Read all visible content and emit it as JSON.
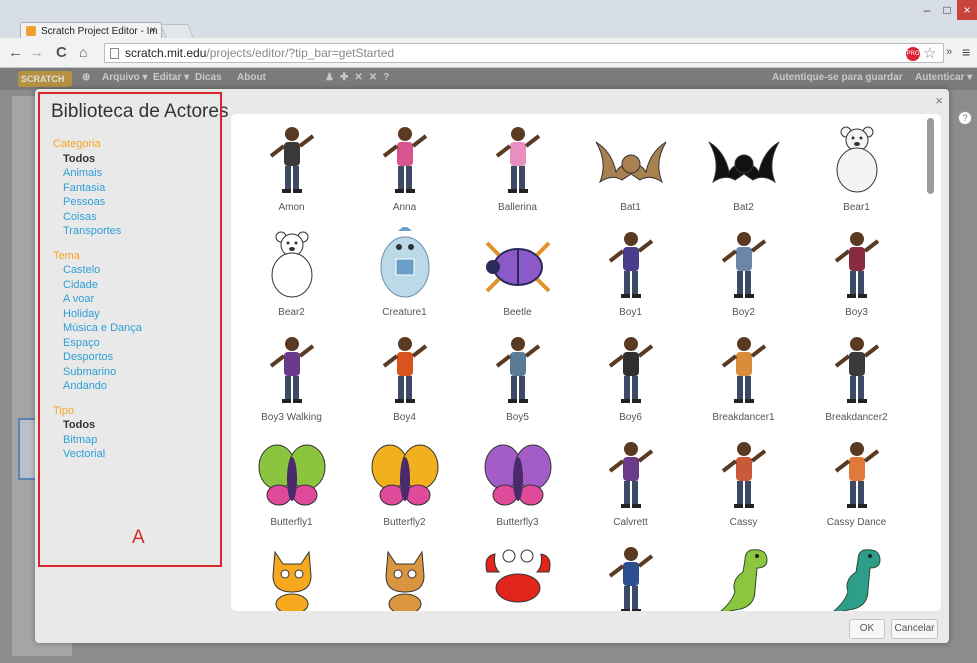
{
  "browser": {
    "tab_title": "Scratch Project Editor - Im",
    "tab_close": "×",
    "url_host": "scratch.mit.edu",
    "url_path": "/projects/editor/?tip_bar=getStarted",
    "window_min": "–",
    "window_max": "□",
    "window_close": "×"
  },
  "scratch_menu": {
    "logo": "SCRATCH",
    "items": [
      "Arquivo ▾",
      "Editar ▾",
      "Dicas",
      "About"
    ],
    "save_hint": "Autentique-se para guardar",
    "signin": "Autenticar ▾"
  },
  "dialog": {
    "title": "Biblioteca de Actores",
    "close": "×",
    "ok_label": "OK",
    "cancel_label": "Cancelar",
    "help": "?",
    "annotation": "A"
  },
  "categories": {
    "categoria_head": "Categoria",
    "categoria_items": [
      "Todos",
      "Animais",
      "Fantasia",
      "Pessoas",
      "Coisas",
      "Transportes"
    ],
    "tema_head": "Tema",
    "tema_items": [
      "Castelo",
      "Cidade",
      "A voar",
      "Holiday",
      "Música e Dança",
      "Espaço",
      "Desportos",
      "Submarino",
      "Andando"
    ],
    "tipo_head": "Tipo",
    "tipo_items": [
      "Todos",
      "Bitmap",
      "Vectorial"
    ]
  },
  "sprites": [
    {
      "name": "Amon",
      "icon": "person-icon",
      "color": "#3a3a3a"
    },
    {
      "name": "Anna",
      "icon": "person-icon",
      "color": "#d9548f"
    },
    {
      "name": "Ballerina",
      "icon": "person-icon",
      "color": "#e88fc0"
    },
    {
      "name": "Bat1",
      "icon": "bat-icon",
      "color": "#a9804f"
    },
    {
      "name": "Bat2",
      "icon": "bat-icon",
      "color": "#111111"
    },
    {
      "name": "Bear1",
      "icon": "bear-icon",
      "color": "#f4f4f4"
    },
    {
      "name": "Bear2",
      "icon": "bear-icon",
      "color": "#ffffff"
    },
    {
      "name": "Creature1",
      "icon": "creature-icon",
      "color": "#bcd9e8"
    },
    {
      "name": "Beetle",
      "icon": "beetle-icon",
      "color": "#8c5ac8"
    },
    {
      "name": "Boy1",
      "icon": "person-icon",
      "color": "#4a3d8c"
    },
    {
      "name": "Boy2",
      "icon": "person-icon",
      "color": "#6c86a8"
    },
    {
      "name": "Boy3",
      "icon": "person-icon",
      "color": "#8a2b3f"
    },
    {
      "name": "Boy3 Walking",
      "icon": "person-icon",
      "color": "#6a3a8a"
    },
    {
      "name": "Boy4",
      "icon": "person-icon",
      "color": "#d9531e"
    },
    {
      "name": "Boy5",
      "icon": "person-icon",
      "color": "#5a7b96"
    },
    {
      "name": "Boy6",
      "icon": "person-icon",
      "color": "#2f2f2f"
    },
    {
      "name": "Breakdancer1",
      "icon": "person-icon",
      "color": "#d98c3a"
    },
    {
      "name": "Breakdancer2",
      "icon": "person-icon",
      "color": "#3a3a3a"
    },
    {
      "name": "Butterfly1",
      "icon": "butterfly-icon",
      "color": "#8bc53f"
    },
    {
      "name": "Butterfly2",
      "icon": "butterfly-icon",
      "color": "#f2b01e"
    },
    {
      "name": "Butterfly3",
      "icon": "butterfly-icon",
      "color": "#a35cc8"
    },
    {
      "name": "Calvrett",
      "icon": "person-icon",
      "color": "#6b3a8a"
    },
    {
      "name": "Cassy",
      "icon": "person-icon",
      "color": "#c85a3a"
    },
    {
      "name": "Cassy Dance",
      "icon": "person-icon",
      "color": "#e07a3a"
    },
    {
      "name": "",
      "icon": "cat-icon",
      "color": "#f7a81e"
    },
    {
      "name": "",
      "icon": "cat-icon",
      "color": "#d9963e"
    },
    {
      "name": "",
      "icon": "crab-icon",
      "color": "#e1251b"
    },
    {
      "name": "",
      "icon": "person-icon",
      "color": "#2d4f8f"
    },
    {
      "name": "",
      "icon": "dinosaur-icon",
      "color": "#8cc63f"
    },
    {
      "name": "",
      "icon": "dinosaur-icon",
      "color": "#2e9e8a"
    }
  ]
}
